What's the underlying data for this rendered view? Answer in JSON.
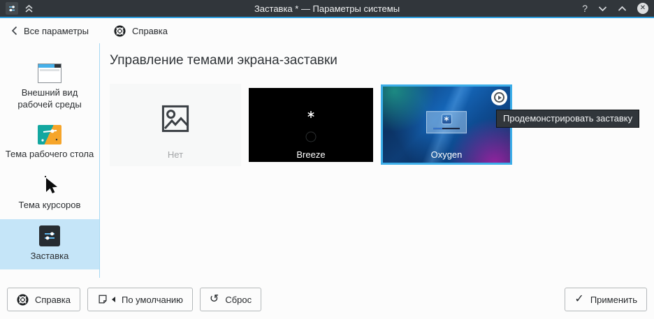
{
  "titlebar": {
    "title": "Заставка * — Параметры системы",
    "help_glyph": "?"
  },
  "toolbar": {
    "back": "Все параметры",
    "help": "Справка"
  },
  "sidebar": {
    "items": [
      {
        "label": "Внешний вид рабочей среды",
        "icon": "desktop-appearance-icon",
        "selected": false
      },
      {
        "label": "Тема рабочего стола",
        "icon": "desktop-theme-icon",
        "selected": false
      },
      {
        "label": "Тема курсоров",
        "icon": "cursor-theme-icon",
        "selected": false
      },
      {
        "label": "Заставка",
        "icon": "screen-locker-icon",
        "selected": true
      }
    ]
  },
  "content": {
    "heading": "Управление темами экрана-заставки",
    "tooltip": "Продемонстрировать заставку",
    "themes": [
      {
        "name": "Нет",
        "selected": false
      },
      {
        "name": "Breeze",
        "selected": false
      },
      {
        "name": "Oxygen",
        "selected": true
      }
    ]
  },
  "footer": {
    "help": "Справка",
    "defaults": "По умолчанию",
    "reset": "Сброс",
    "apply": "Применить"
  },
  "icons": {
    "close": "✕",
    "reset": "↺",
    "check": "✓"
  },
  "colors": {
    "accent": "#3daee9",
    "titlebar_bg": "#31363b",
    "selection_bg": "#c5e5f8",
    "window_bg": "#fcfcfc",
    "tooltip_bg": "#31363b"
  }
}
